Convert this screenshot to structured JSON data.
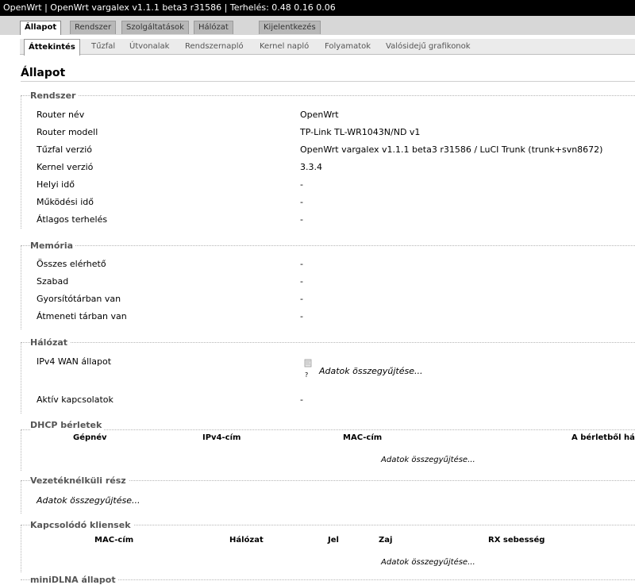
{
  "header": {
    "title": "OpenWrt | OpenWrt vargalex v1.1.1 beta3 r31586 | Terhelés: 0.48 0.16 0.06"
  },
  "main_tabs": [
    "Állapot",
    "Rendszer",
    "Szolgáltatások",
    "Hálózat",
    "Kijelentkezés"
  ],
  "sub_tabs": [
    "Áttekintés",
    "Tűzfal",
    "Útvonalak",
    "Rendszernapló",
    "Kernel napló",
    "Folyamatok",
    "Valósidejű grafikonok"
  ],
  "page_title": "Állapot",
  "system": {
    "legend": "Rendszer",
    "rows": [
      {
        "label": "Router név",
        "value": "OpenWrt"
      },
      {
        "label": "Router modell",
        "value": "TP-Link TL-WR1043N/ND v1"
      },
      {
        "label": "Tűzfal verzió",
        "value": "OpenWrt vargalex v1.1.1 beta3 r31586 / LuCI Trunk (trunk+svn8672)"
      },
      {
        "label": "Kernel verzió",
        "value": "3.3.4"
      },
      {
        "label": "Helyi idő",
        "value": "-"
      },
      {
        "label": "Működési idő",
        "value": "-"
      },
      {
        "label": "Átlagos terhelés",
        "value": "-"
      }
    ]
  },
  "memory": {
    "legend": "Memória",
    "rows": [
      {
        "label": "Összes elérhető",
        "value": "-"
      },
      {
        "label": "Szabad",
        "value": "-"
      },
      {
        "label": "Gyorsítótárban van",
        "value": "-"
      },
      {
        "label": "Átmeneti tárban van",
        "value": "-"
      }
    ]
  },
  "network": {
    "legend": "Hálózat",
    "wan_label": "IPv4 WAN állapot",
    "wan_spinner_glyph": "?",
    "wan_value": "Adatok összegyűjtése...",
    "conn_label": "Aktív kapcsolatok",
    "conn_value": "-"
  },
  "dhcp": {
    "legend": "DHCP bérletek",
    "columns": [
      "Gépnév",
      "IPv4-cím",
      "MAC-cím",
      "A bérletből há"
    ],
    "loading": "Adatok összegyűjtése..."
  },
  "wireless": {
    "legend": "Vezetéknélküli rész",
    "loading": "Adatok összegyűjtése..."
  },
  "clients": {
    "legend": "Kapcsolódó kliensek",
    "columns": [
      "MAC-cím",
      "Hálózat",
      "Jel",
      "Zaj",
      "RX sebesség"
    ],
    "loading": "Adatok összegyűjtése..."
  },
  "minidlna": {
    "legend": "miniDLNA állapot"
  },
  "colors": {
    "topbar": "#000000",
    "tabbar": "#d7d7d7",
    "legend_text": "#555555"
  }
}
